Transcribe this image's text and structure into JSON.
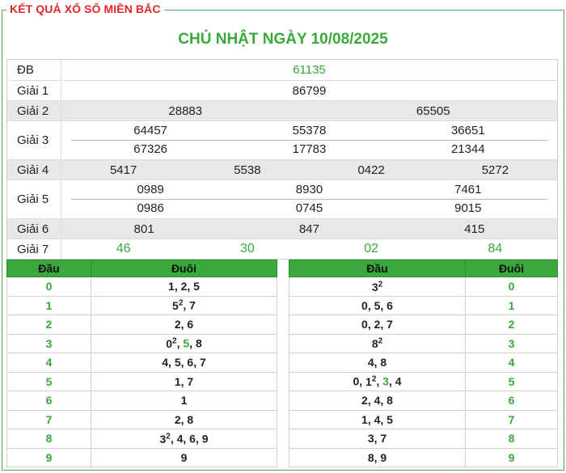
{
  "header": {
    "section_title": "KẾT QUẢ XỔ SỐ MIỀN BẮC",
    "date_title": "CHỦ NHẬT NGÀY 10/08/2025"
  },
  "results": {
    "db": {
      "label": "ĐB",
      "values": [
        "61135"
      ]
    },
    "g1": {
      "label": "Giải 1",
      "values": [
        "86799"
      ]
    },
    "g2": {
      "label": "Giải 2",
      "values": [
        "28883",
        "65505"
      ]
    },
    "g3": {
      "label": "Giải 3",
      "values": [
        "64457",
        "55378",
        "36651",
        "67326",
        "17783",
        "21344"
      ]
    },
    "g4": {
      "label": "Giải 4",
      "values": [
        "5417",
        "5538",
        "0422",
        "5272"
      ]
    },
    "g5": {
      "label": "Giải 5",
      "values": [
        "0989",
        "8930",
        "7461",
        "0986",
        "0745",
        "9015"
      ]
    },
    "g6": {
      "label": "Giải 6",
      "values": [
        "801",
        "847",
        "415"
      ]
    },
    "g7": {
      "label": "Giải 7",
      "values": [
        "46",
        "30",
        "02",
        "84"
      ]
    }
  },
  "loto_head": {
    "col_head": "Đầu",
    "col_tail": "Đuôi",
    "rows": [
      {
        "key": "0",
        "text": "1, 2, 5"
      },
      {
        "key": "1",
        "text": "5², 7"
      },
      {
        "key": "2",
        "text": "2, 6"
      },
      {
        "key": "3",
        "text": "0², 5, 8"
      },
      {
        "key": "4",
        "text": "4, 5, 6, 7"
      },
      {
        "key": "5",
        "text": "1, 7"
      },
      {
        "key": "6",
        "text": "1"
      },
      {
        "key": "7",
        "text": "2, 8"
      },
      {
        "key": "8",
        "text": "3², 4, 6, 9"
      },
      {
        "key": "9",
        "text": "9"
      }
    ]
  },
  "loto_tail": {
    "col_head": "Đầu",
    "col_tail": "Đuôi",
    "rows": [
      {
        "key": "0",
        "text": "3²"
      },
      {
        "key": "1",
        "text": "0, 5, 6"
      },
      {
        "key": "2",
        "text": "0, 2, 7"
      },
      {
        "key": "3",
        "text": "8²"
      },
      {
        "key": "4",
        "text": "4, 8"
      },
      {
        "key": "5",
        "text": "0, 1², 3, 4"
      },
      {
        "key": "6",
        "text": "2, 4, 8"
      },
      {
        "key": "7",
        "text": "1, 4, 5"
      },
      {
        "key": "8",
        "text": "3, 7"
      },
      {
        "key": "9",
        "text": "8, 9"
      }
    ]
  },
  "colors": {
    "accent": "#3aa83a",
    "title_red": "#e0262a"
  }
}
